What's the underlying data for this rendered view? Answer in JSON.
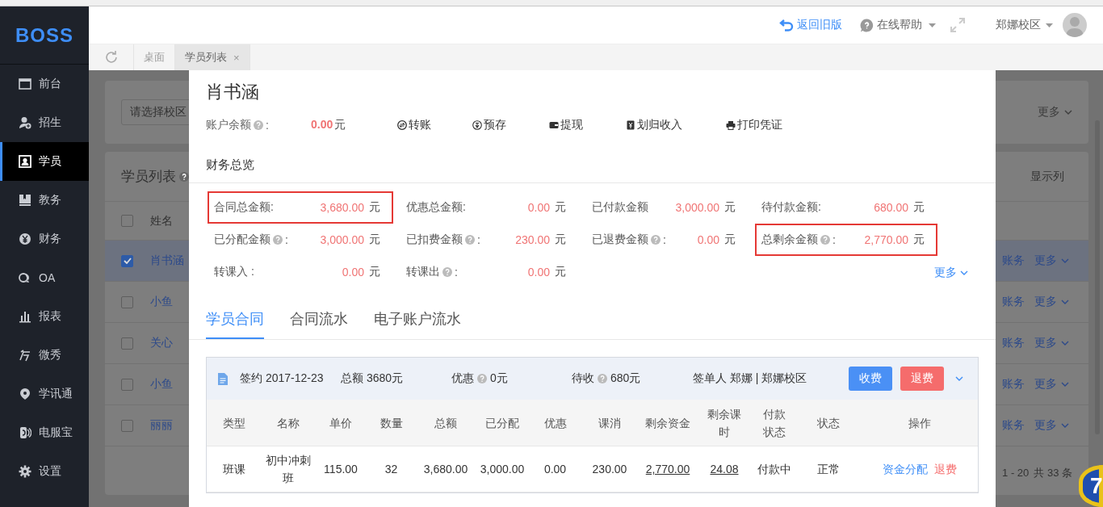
{
  "sidebar": {
    "logo": "BOSS",
    "items": [
      {
        "label": "前台",
        "selected": false
      },
      {
        "label": "招生",
        "selected": false
      },
      {
        "label": "学员",
        "selected": true
      },
      {
        "label": "教务",
        "selected": false
      },
      {
        "label": "财务",
        "selected": false
      },
      {
        "label": "OA",
        "selected": false
      },
      {
        "label": "报表",
        "selected": false
      },
      {
        "label": "微秀",
        "selected": false
      },
      {
        "label": "学讯通",
        "selected": false
      },
      {
        "label": "电服宝",
        "selected": false
      },
      {
        "label": "设置",
        "selected": false
      }
    ]
  },
  "header": {
    "back_link": "返回旧版",
    "help": "在线帮助",
    "campus": "郑娜校区"
  },
  "page_tabs": [
    {
      "label": "桌面",
      "selected": false
    },
    {
      "label": "学员列表",
      "selected": true,
      "close": "×"
    }
  ],
  "background": {
    "campus_select": {
      "placeholder": "请选择校区"
    },
    "filter_more": "更多",
    "list_title": "学员列表",
    "columns_button": "显示列",
    "name_header": "姓名",
    "header_checked": false,
    "rows": [
      {
        "name": "肖书涵",
        "checked": true,
        "selected": true,
        "actions": [
          "账务",
          "更多"
        ]
      },
      {
        "name": "小鱼",
        "checked": false,
        "selected": false,
        "actions": [
          "账务",
          "更多"
        ]
      },
      {
        "name": "关心",
        "checked": false,
        "selected": false,
        "actions": [
          "账务",
          "更多"
        ]
      },
      {
        "name": "小鱼",
        "checked": false,
        "selected": false,
        "actions": [
          "账务",
          "更多"
        ]
      },
      {
        "name": "丽丽",
        "checked": false,
        "selected": false,
        "actions": [
          "账务",
          "更多"
        ]
      }
    ],
    "pagination": {
      "range": "1 - 20",
      "total": "共 33 条"
    }
  },
  "floating_badge": "7",
  "modal": {
    "student_name": "肖书涵",
    "account": {
      "label": "账户余额",
      "colon": ":",
      "value": "0.00",
      "unit": "元",
      "actions": [
        "转账",
        "预存",
        "提现",
        "划归收入",
        "打印凭证"
      ]
    },
    "overview_title": "财务总览",
    "stats": [
      {
        "label": "合同总金额:",
        "help": false,
        "value": "3,680.00",
        "unit": "元",
        "highlighted": true
      },
      {
        "label": "优惠总金额:",
        "help": false,
        "value": "0.00",
        "unit": "元",
        "highlighted": false
      },
      {
        "label": "已付款金额",
        "help": false,
        "value": "3,000.00",
        "unit": "元",
        "highlighted": false
      },
      {
        "label": "待付款金额:",
        "help": false,
        "value": "680.00",
        "unit": "元",
        "highlighted": false
      },
      {
        "label": "已分配金额",
        "help": true,
        "colon": ":",
        "value": "3,000.00",
        "unit": "元",
        "highlighted": false
      },
      {
        "label": "已扣费金额",
        "help": true,
        "colon": ":",
        "value": "230.00",
        "unit": "元",
        "highlighted": false
      },
      {
        "label": "已退费金额",
        "help": true,
        "colon": ":",
        "value": "0.00",
        "unit": "元",
        "highlighted": false
      },
      {
        "label": "总剩余金额",
        "help": true,
        "colon": ":",
        "value": "2,770.00",
        "unit": "元",
        "highlighted": true
      },
      {
        "label": "转课入 :",
        "help": false,
        "value": "0.00",
        "unit": "元",
        "highlighted": false
      },
      {
        "label": "转课出",
        "help": true,
        "colon": ":",
        "value": "0.00",
        "unit": "元",
        "highlighted": false
      }
    ],
    "more_link": "更多",
    "tabs": [
      {
        "label": "学员合同",
        "selected": true
      },
      {
        "label": "合同流水",
        "selected": false
      },
      {
        "label": "电子账户流水",
        "selected": false
      }
    ],
    "contract": {
      "sign": "签约 2017-12-23",
      "total": "总额 3680元",
      "discount_label": "优惠",
      "discount": "0元",
      "due_label": "待收",
      "due": "680元",
      "signer": "签单人 郑娜 | 郑娜校区",
      "buttons": [
        {
          "label": "收费",
          "kind": "primary"
        },
        {
          "label": "退费",
          "kind": "danger"
        }
      ],
      "columns": [
        "类型",
        "名称",
        "单价",
        "数量",
        "总额",
        "已分配",
        "优惠",
        "课消",
        "剩余资金",
        "剩余课时",
        "付款状态",
        "状态",
        "操作"
      ],
      "rows": [
        {
          "cells": [
            {
              "text": "班课",
              "underlined": false
            },
            {
              "text": "初中冲刺班",
              "underlined": false
            },
            {
              "text": "115.00",
              "underlined": false
            },
            {
              "text": "32",
              "underlined": false
            },
            {
              "text": "3,680.00",
              "underlined": false
            },
            {
              "text": "3,000.00",
              "underlined": false
            },
            {
              "text": "0.00",
              "underlined": false
            },
            {
              "text": "230.00",
              "underlined": false
            },
            {
              "text": "2,770.00",
              "underlined": true
            },
            {
              "text": "24.08",
              "underlined": true
            },
            {
              "text": "付款中",
              "underlined": false
            },
            {
              "text": "正常",
              "underlined": false
            }
          ],
          "actions": [
            {
              "label": "资金分配",
              "kind": "link"
            },
            {
              "label": "退费",
              "kind": "danger"
            }
          ]
        }
      ]
    }
  }
}
